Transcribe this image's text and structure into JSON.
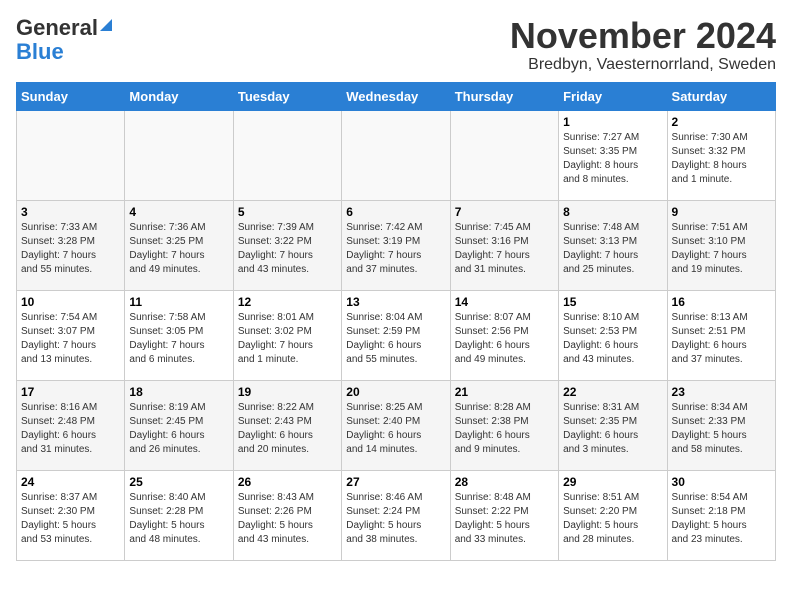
{
  "header": {
    "logo_line1": "General",
    "logo_line2": "Blue",
    "month": "November 2024",
    "location": "Bredbyn, Vaesternorrland, Sweden"
  },
  "weekdays": [
    "Sunday",
    "Monday",
    "Tuesday",
    "Wednesday",
    "Thursday",
    "Friday",
    "Saturday"
  ],
  "weeks": [
    [
      {
        "day": "",
        "info": ""
      },
      {
        "day": "",
        "info": ""
      },
      {
        "day": "",
        "info": ""
      },
      {
        "day": "",
        "info": ""
      },
      {
        "day": "",
        "info": ""
      },
      {
        "day": "1",
        "info": "Sunrise: 7:27 AM\nSunset: 3:35 PM\nDaylight: 8 hours\nand 8 minutes."
      },
      {
        "day": "2",
        "info": "Sunrise: 7:30 AM\nSunset: 3:32 PM\nDaylight: 8 hours\nand 1 minute."
      }
    ],
    [
      {
        "day": "3",
        "info": "Sunrise: 7:33 AM\nSunset: 3:28 PM\nDaylight: 7 hours\nand 55 minutes."
      },
      {
        "day": "4",
        "info": "Sunrise: 7:36 AM\nSunset: 3:25 PM\nDaylight: 7 hours\nand 49 minutes."
      },
      {
        "day": "5",
        "info": "Sunrise: 7:39 AM\nSunset: 3:22 PM\nDaylight: 7 hours\nand 43 minutes."
      },
      {
        "day": "6",
        "info": "Sunrise: 7:42 AM\nSunset: 3:19 PM\nDaylight: 7 hours\nand 37 minutes."
      },
      {
        "day": "7",
        "info": "Sunrise: 7:45 AM\nSunset: 3:16 PM\nDaylight: 7 hours\nand 31 minutes."
      },
      {
        "day": "8",
        "info": "Sunrise: 7:48 AM\nSunset: 3:13 PM\nDaylight: 7 hours\nand 25 minutes."
      },
      {
        "day": "9",
        "info": "Sunrise: 7:51 AM\nSunset: 3:10 PM\nDaylight: 7 hours\nand 19 minutes."
      }
    ],
    [
      {
        "day": "10",
        "info": "Sunrise: 7:54 AM\nSunset: 3:07 PM\nDaylight: 7 hours\nand 13 minutes."
      },
      {
        "day": "11",
        "info": "Sunrise: 7:58 AM\nSunset: 3:05 PM\nDaylight: 7 hours\nand 6 minutes."
      },
      {
        "day": "12",
        "info": "Sunrise: 8:01 AM\nSunset: 3:02 PM\nDaylight: 7 hours\nand 1 minute."
      },
      {
        "day": "13",
        "info": "Sunrise: 8:04 AM\nSunset: 2:59 PM\nDaylight: 6 hours\nand 55 minutes."
      },
      {
        "day": "14",
        "info": "Sunrise: 8:07 AM\nSunset: 2:56 PM\nDaylight: 6 hours\nand 49 minutes."
      },
      {
        "day": "15",
        "info": "Sunrise: 8:10 AM\nSunset: 2:53 PM\nDaylight: 6 hours\nand 43 minutes."
      },
      {
        "day": "16",
        "info": "Sunrise: 8:13 AM\nSunset: 2:51 PM\nDaylight: 6 hours\nand 37 minutes."
      }
    ],
    [
      {
        "day": "17",
        "info": "Sunrise: 8:16 AM\nSunset: 2:48 PM\nDaylight: 6 hours\nand 31 minutes."
      },
      {
        "day": "18",
        "info": "Sunrise: 8:19 AM\nSunset: 2:45 PM\nDaylight: 6 hours\nand 26 minutes."
      },
      {
        "day": "19",
        "info": "Sunrise: 8:22 AM\nSunset: 2:43 PM\nDaylight: 6 hours\nand 20 minutes."
      },
      {
        "day": "20",
        "info": "Sunrise: 8:25 AM\nSunset: 2:40 PM\nDaylight: 6 hours\nand 14 minutes."
      },
      {
        "day": "21",
        "info": "Sunrise: 8:28 AM\nSunset: 2:38 PM\nDaylight: 6 hours\nand 9 minutes."
      },
      {
        "day": "22",
        "info": "Sunrise: 8:31 AM\nSunset: 2:35 PM\nDaylight: 6 hours\nand 3 minutes."
      },
      {
        "day": "23",
        "info": "Sunrise: 8:34 AM\nSunset: 2:33 PM\nDaylight: 5 hours\nand 58 minutes."
      }
    ],
    [
      {
        "day": "24",
        "info": "Sunrise: 8:37 AM\nSunset: 2:30 PM\nDaylight: 5 hours\nand 53 minutes."
      },
      {
        "day": "25",
        "info": "Sunrise: 8:40 AM\nSunset: 2:28 PM\nDaylight: 5 hours\nand 48 minutes."
      },
      {
        "day": "26",
        "info": "Sunrise: 8:43 AM\nSunset: 2:26 PM\nDaylight: 5 hours\nand 43 minutes."
      },
      {
        "day": "27",
        "info": "Sunrise: 8:46 AM\nSunset: 2:24 PM\nDaylight: 5 hours\nand 38 minutes."
      },
      {
        "day": "28",
        "info": "Sunrise: 8:48 AM\nSunset: 2:22 PM\nDaylight: 5 hours\nand 33 minutes."
      },
      {
        "day": "29",
        "info": "Sunrise: 8:51 AM\nSunset: 2:20 PM\nDaylight: 5 hours\nand 28 minutes."
      },
      {
        "day": "30",
        "info": "Sunrise: 8:54 AM\nSunset: 2:18 PM\nDaylight: 5 hours\nand 23 minutes."
      }
    ]
  ]
}
